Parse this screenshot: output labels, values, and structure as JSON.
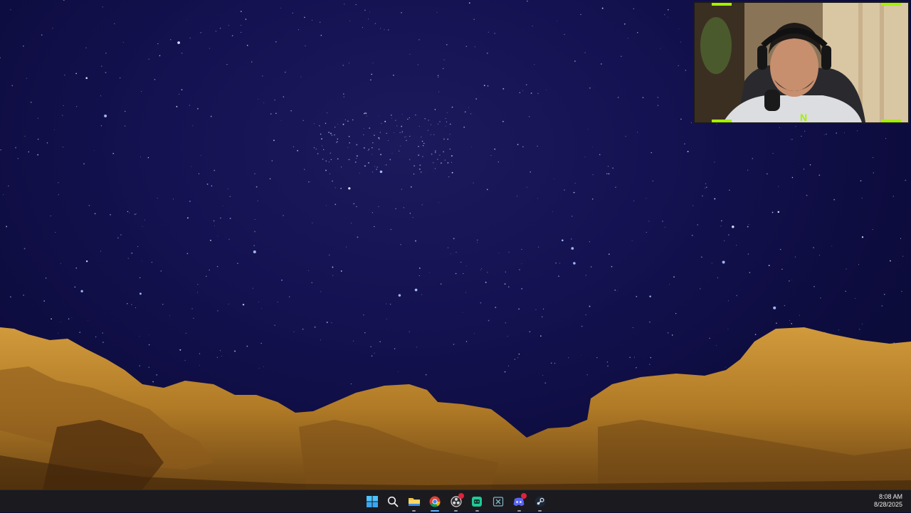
{
  "taskbar": {
    "time": "8:08 AM",
    "date": "8/28/2025",
    "apps": [
      {
        "name": "start-button",
        "icon": "windows-logo-icon"
      },
      {
        "name": "search-button",
        "icon": "search-icon"
      },
      {
        "name": "file-explorer-button",
        "icon": "folder-icon"
      },
      {
        "name": "chrome-button",
        "icon": "chrome-icon"
      },
      {
        "name": "obs-button",
        "icon": "obs-icon"
      },
      {
        "name": "green-app-button",
        "icon": "app-icon"
      },
      {
        "name": "excel-button",
        "icon": "excel-icon"
      },
      {
        "name": "discord-button",
        "icon": "discord-icon"
      },
      {
        "name": "steam-button",
        "icon": "steam-icon"
      }
    ]
  },
  "colors": {
    "sky": "#141251",
    "rock": "#b9822a",
    "taskbar": "#1b1b1f",
    "accent": "#5fb2ff",
    "webcam_frame": "#a4f000"
  }
}
